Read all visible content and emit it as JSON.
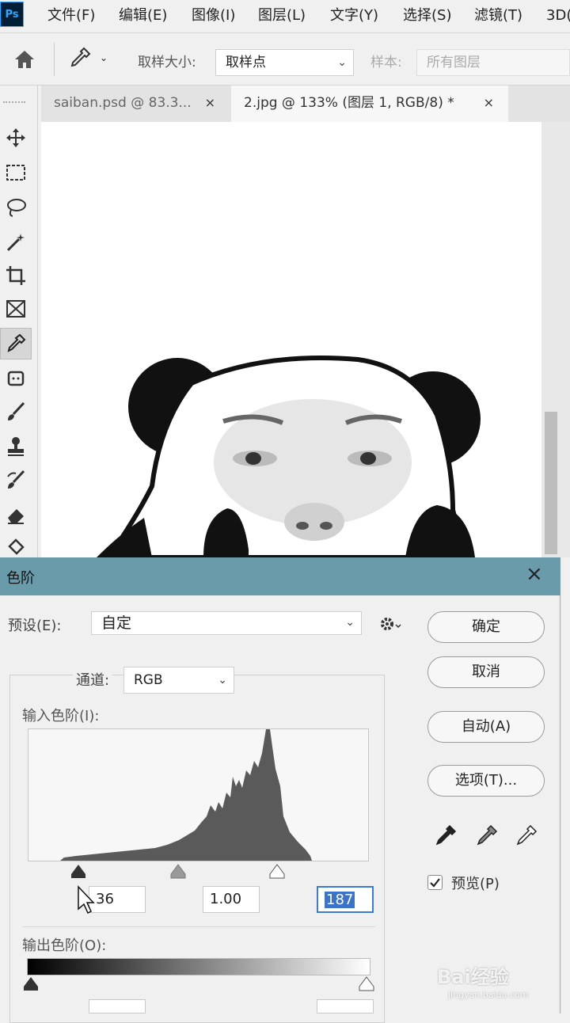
{
  "app": {
    "logo": "Ps"
  },
  "menu": [
    "文件(F)",
    "编辑(E)",
    "图像(I)",
    "图层(L)",
    "文字(Y)",
    "选择(S)",
    "滤镜(T)",
    "3D("
  ],
  "options": {
    "sample_size_label": "取样大小:",
    "sample_size_value": "取样点",
    "sample_label": "样本:",
    "sample_value": "所有图层"
  },
  "tabs": [
    {
      "label": "saiban.psd @ 83.3...",
      "close": "×"
    },
    {
      "label": "2.jpg @ 133% (图层 1, RGB/8) *",
      "close": "×"
    }
  ],
  "tools": [
    "move-icon",
    "marquee-icon",
    "lasso-icon",
    "magic-wand-icon",
    "crop-icon",
    "frame-icon",
    "eyedropper-icon",
    "patch-icon",
    "brush-icon",
    "stamp-icon",
    "history-brush-icon",
    "eraser-icon",
    "paint-bucket-icon"
  ],
  "dialog": {
    "title": "色阶",
    "close": "×",
    "preset_label": "预设(E):",
    "preset_value": "自定",
    "channel_label": "通道:",
    "channel_value": "RGB",
    "input_label": "输入色阶(I):",
    "input_black": "36",
    "input_gamma": "1.00",
    "input_white": "187",
    "output_label": "输出色阶(O):",
    "buttons": {
      "ok": "确定",
      "cancel": "取消",
      "auto": "自动(A)",
      "options": "选项(T)..."
    },
    "preview_label": "预览(P)",
    "preview_checked": true
  },
  "watermark": {
    "brand": "Bai经验",
    "url": "jingyan.baidu.com"
  },
  "colors": {
    "title_bar": "#6a9bab",
    "ps_blue": "#31a8ff",
    "histogram": "#5a5a5a"
  }
}
